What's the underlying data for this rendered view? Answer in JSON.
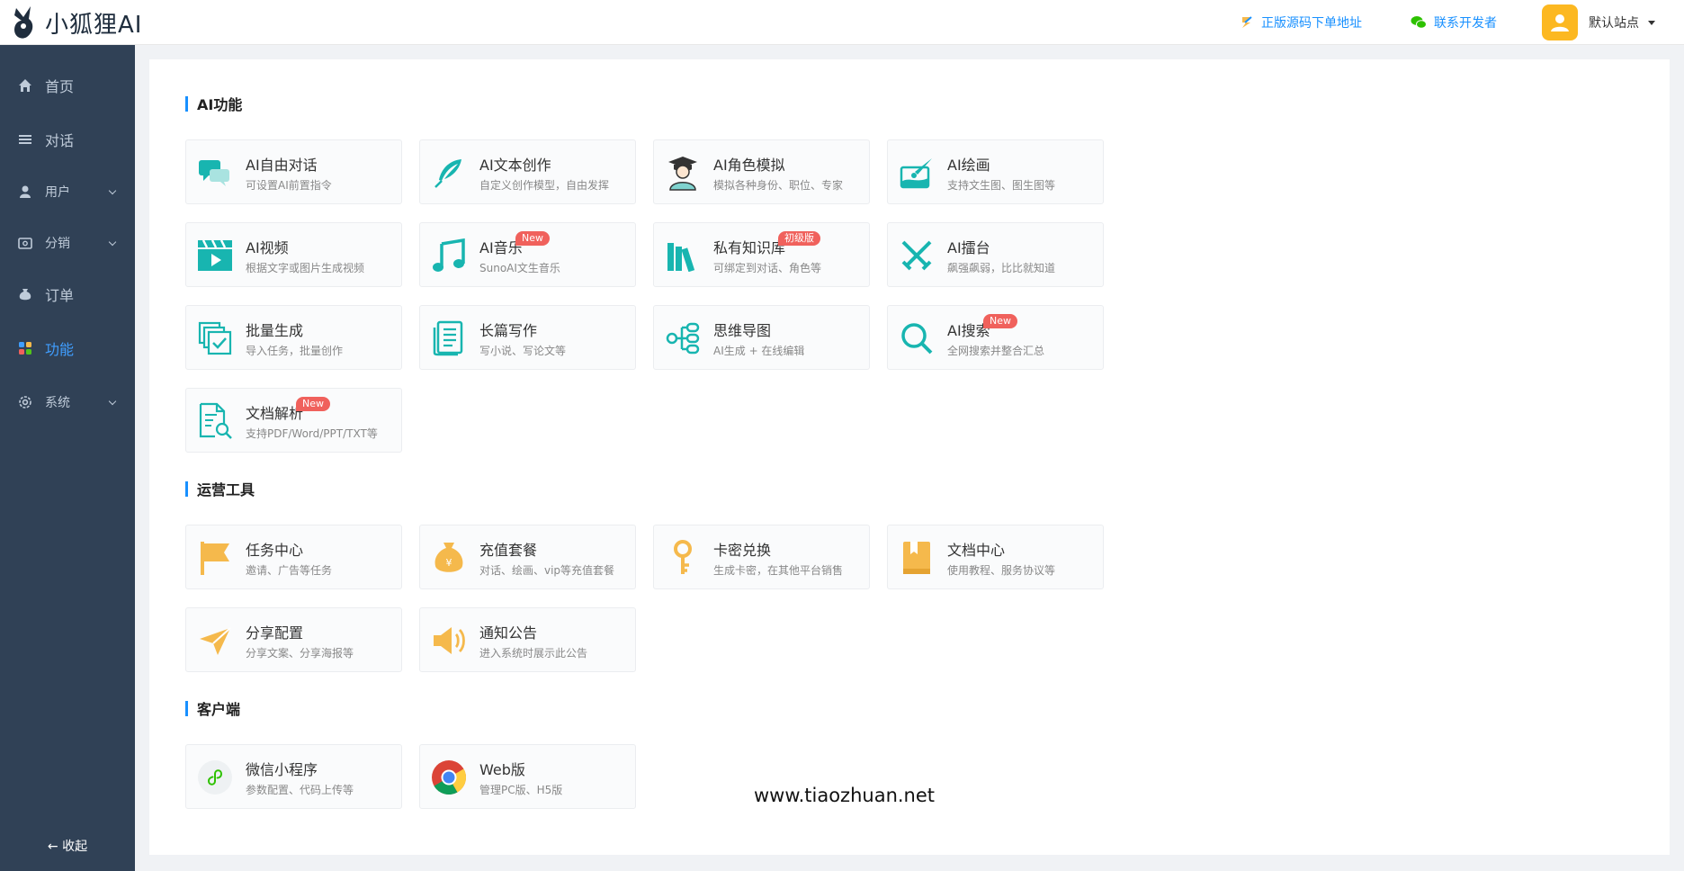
{
  "brand": {
    "name": "小狐狸AI"
  },
  "header": {
    "link_source": "正版源码下单地址",
    "link_contact": "联系开发者",
    "site_name": "默认站点"
  },
  "sidebar": {
    "items": [
      {
        "label": "首页",
        "icon": "home-icon"
      },
      {
        "label": "对话",
        "icon": "list-icon"
      },
      {
        "label": "用户",
        "icon": "user-icon"
      },
      {
        "label": "分销",
        "icon": "wallet-icon"
      },
      {
        "label": "订单",
        "icon": "moneybag-icon"
      },
      {
        "label": "功能",
        "icon": "apps-icon"
      },
      {
        "label": "系统",
        "icon": "settings-icon"
      }
    ],
    "collapse_label": "← 收起"
  },
  "sections": {
    "ai": {
      "title": "AI功能",
      "cards": [
        {
          "title": "AI自由对话",
          "desc": "可设置AI前置指令"
        },
        {
          "title": "AI文本创作",
          "desc": "自定义创作模型，自由发挥"
        },
        {
          "title": "AI角色模拟",
          "desc": "模拟各种身份、职位、专家"
        },
        {
          "title": "AI绘画",
          "desc": "支持文生图、图生图等"
        },
        {
          "title": "AI视频",
          "desc": "根据文字或图片生成视频"
        },
        {
          "title": "AI音乐",
          "desc": "SunoAI文生音乐",
          "badge": "New"
        },
        {
          "title": "私有知识库",
          "desc": "可绑定到对话、角色等",
          "badge": "初级版"
        },
        {
          "title": "AI擂台",
          "desc": "飙强飙弱，比比就知道"
        },
        {
          "title": "批量生成",
          "desc": "导入任务，批量创作"
        },
        {
          "title": "长篇写作",
          "desc": "写小说、写论文等"
        },
        {
          "title": "思维导图",
          "desc": "AI生成 + 在线编辑"
        },
        {
          "title": "AI搜索",
          "desc": "全网搜索并整合汇总",
          "badge": "New"
        },
        {
          "title": "文档解析",
          "desc": "支持PDF/Word/PPT/TXT等",
          "badge": "New"
        }
      ]
    },
    "ops": {
      "title": "运营工具",
      "cards": [
        {
          "title": "任务中心",
          "desc": "邀请、广告等任务"
        },
        {
          "title": "充值套餐",
          "desc": "对话、绘画、vip等充值套餐"
        },
        {
          "title": "卡密兑换",
          "desc": "生成卡密，在其他平台销售"
        },
        {
          "title": "文档中心",
          "desc": "使用教程、服务协议等"
        },
        {
          "title": "分享配置",
          "desc": "分享文案、分享海报等"
        },
        {
          "title": "通知公告",
          "desc": "进入系统时展示此公告"
        }
      ]
    },
    "client": {
      "title": "客户端",
      "cards": [
        {
          "title": "微信小程序",
          "desc": "参数配置、代码上传等"
        },
        {
          "title": "Web版",
          "desc": "管理PC版、H5版"
        }
      ]
    }
  },
  "watermark": "www.tiaozhuan.net",
  "colors": {
    "teal": "#18b5b0",
    "orange": "#f5b94c",
    "sidebar": "#304156",
    "active": "#409eff"
  }
}
